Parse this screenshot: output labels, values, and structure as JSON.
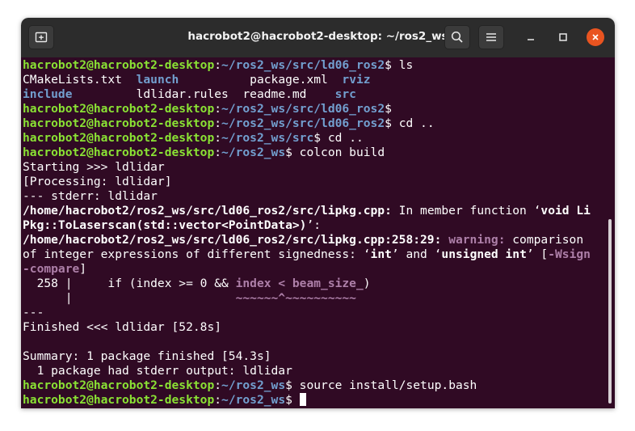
{
  "window": {
    "title": "hacrobot2@hacrobot2-desktop: ~/ros2_ws",
    "colors": {
      "titlebar": "#2c2c2c",
      "terminal_bg": "#300a24",
      "close_button": "#e95420"
    }
  },
  "titlebar": {
    "new_tab_icon": "new-tab-icon",
    "search_icon": "search-icon",
    "menu_icon": "hamburger-menu-icon",
    "minimize_icon": "minimize-icon",
    "maximize_icon": "maximize-icon",
    "close_icon": "close-icon"
  },
  "terminal": {
    "colors": {
      "user": "#8ae234",
      "path": "#729fcf",
      "warning": "#ad7fa8",
      "text": "#ffffff"
    },
    "lines": [
      [
        {
          "t": "hacrobot2@hacrobot2-desktop",
          "c": "u"
        },
        {
          "t": ":",
          "c": "w"
        },
        {
          "t": "~/ros2_ws/src/ld06_ros2",
          "c": "p"
        },
        {
          "t": "$ ls",
          "c": "w"
        }
      ],
      [
        {
          "t": "CMakeLists.txt  ",
          "c": "w"
        },
        {
          "t": "launch",
          "c": "d"
        },
        {
          "t": "          package.xml  ",
          "c": "w"
        },
        {
          "t": "rviz",
          "c": "d"
        }
      ],
      [
        {
          "t": "include",
          "c": "d"
        },
        {
          "t": "         ldlidar.rules  readme.md    ",
          "c": "w"
        },
        {
          "t": "src",
          "c": "d"
        }
      ],
      [
        {
          "t": "hacrobot2@hacrobot2-desktop",
          "c": "u"
        },
        {
          "t": ":",
          "c": "w"
        },
        {
          "t": "~/ros2_ws/src/ld06_ros2",
          "c": "p"
        },
        {
          "t": "$",
          "c": "w"
        }
      ],
      [
        {
          "t": "hacrobot2@hacrobot2-desktop",
          "c": "u"
        },
        {
          "t": ":",
          "c": "w"
        },
        {
          "t": "~/ros2_ws/src/ld06_ros2",
          "c": "p"
        },
        {
          "t": "$ cd ..",
          "c": "w"
        }
      ],
      [
        {
          "t": "hacrobot2@hacrobot2-desktop",
          "c": "u"
        },
        {
          "t": ":",
          "c": "w"
        },
        {
          "t": "~/ros2_ws/src",
          "c": "p"
        },
        {
          "t": "$ cd ..",
          "c": "w"
        }
      ],
      [
        {
          "t": "hacrobot2@hacrobot2-desktop",
          "c": "u"
        },
        {
          "t": ":",
          "c": "w"
        },
        {
          "t": "~/ros2_ws",
          "c": "p"
        },
        {
          "t": "$ colcon build",
          "c": "w"
        }
      ],
      [
        {
          "t": "Starting >>> ldlidar",
          "c": "w"
        }
      ],
      [
        {
          "t": "[Processing: ldlidar]",
          "c": "w"
        }
      ],
      [
        {
          "t": "--- stderr: ldlidar",
          "c": "w"
        }
      ],
      [
        {
          "t": "/home/hacrobot2/ros2_ws/src/ld06_ros2/src/lipkg.cpp:",
          "c": "b"
        },
        {
          "t": " In member function ",
          "c": "w"
        },
        {
          "t": "‘",
          "c": "w"
        },
        {
          "t": "void Li",
          "c": "b"
        }
      ],
      [
        {
          "t": "Pkg::ToLaserscan(std::vector<PointData>)",
          "c": "b"
        },
        {
          "t": "’:",
          "c": "w"
        }
      ],
      [
        {
          "t": "/home/hacrobot2/ros2_ws/src/ld06_ros2/src/lipkg.cpp:258:29:",
          "c": "b"
        },
        {
          "t": " ",
          "c": "w"
        },
        {
          "t": "warning:",
          "c": "warn"
        },
        {
          "t": " comparison",
          "c": "w"
        }
      ],
      [
        {
          "t": "of integer expressions of different signedness: ",
          "c": "w"
        },
        {
          "t": "‘",
          "c": "w"
        },
        {
          "t": "int",
          "c": "b"
        },
        {
          "t": "’ and ‘",
          "c": "w"
        },
        {
          "t": "unsigned int",
          "c": "b"
        },
        {
          "t": "’ [",
          "c": "w"
        },
        {
          "t": "-Wsign",
          "c": "warn"
        }
      ],
      [
        {
          "t": "-compare",
          "c": "warn"
        },
        {
          "t": "]",
          "c": "w"
        }
      ],
      [
        {
          "t": "  258 |     if (index >= 0 && ",
          "c": "w"
        },
        {
          "t": "index < beam_size_",
          "c": "warn"
        },
        {
          "t": ")",
          "c": "w"
        }
      ],
      [
        {
          "t": "      |                       ",
          "c": "w"
        },
        {
          "t": "~~~~~~^~~~~~~~~~~",
          "c": "warn"
        }
      ],
      [
        {
          "t": "---",
          "c": "w"
        }
      ],
      [
        {
          "t": "Finished <<< ldlidar [52.8s]",
          "c": "w"
        }
      ],
      [
        {
          "t": "",
          "c": "w"
        }
      ],
      [
        {
          "t": "Summary: 1 package finished [54.3s]",
          "c": "w"
        }
      ],
      [
        {
          "t": "  1 package had stderr output: ldlidar",
          "c": "w"
        }
      ],
      [
        {
          "t": "hacrobot2@hacrobot2-desktop",
          "c": "u"
        },
        {
          "t": ":",
          "c": "w"
        },
        {
          "t": "~/ros2_ws",
          "c": "p"
        },
        {
          "t": "$ source install/setup.bash",
          "c": "w"
        }
      ],
      [
        {
          "t": "hacrobot2@hacrobot2-desktop",
          "c": "u"
        },
        {
          "t": ":",
          "c": "w"
        },
        {
          "t": "~/ros2_ws",
          "c": "p"
        },
        {
          "t": "$ ",
          "c": "w"
        }
      ]
    ]
  }
}
